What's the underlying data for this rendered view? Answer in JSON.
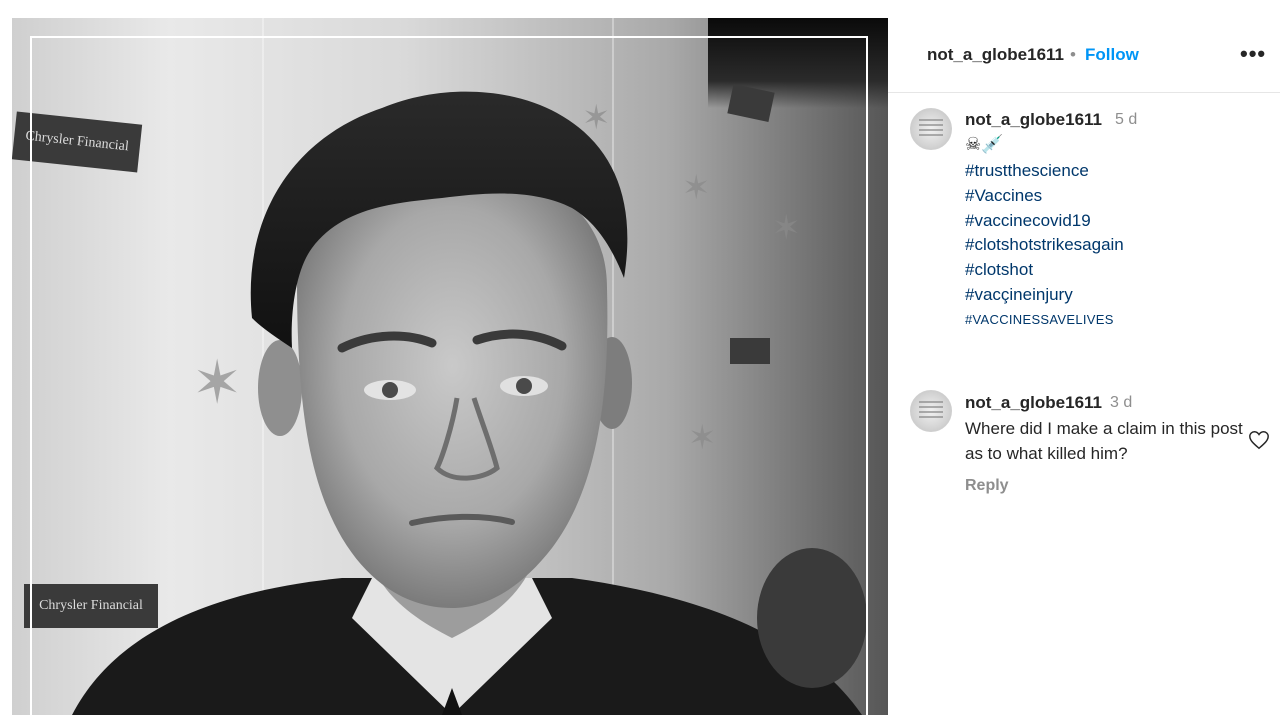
{
  "post": {
    "image": {
      "description_icon": "portrait-photo",
      "sign_text_1": "Chrysler Financial",
      "sign_text_2": "Chrysler Financial"
    }
  },
  "header": {
    "username": "not_a_globe1611",
    "separator": "•",
    "follow_label": "Follow",
    "more_label": "•••"
  },
  "caption": {
    "username": "not_a_globe1611",
    "time": "5 d",
    "emojis": "☠💉",
    "hashtags": [
      "#trustthescience",
      "#Vaccines",
      "#vaccinecovid19",
      "#clotshotstrikesagain",
      "#clotshot",
      "#vacçineinjury",
      "#VACCINESSAVELIVES"
    ]
  },
  "comment": {
    "username": "not_a_globe1611",
    "time": "3 d",
    "text": "Where did I make a claim in this post as to what killed him?",
    "reply_label": "Reply"
  },
  "colors": {
    "accent": "#0095f6",
    "hashtag": "#00376b",
    "text": "#262626",
    "muted": "#8e8e8e"
  }
}
